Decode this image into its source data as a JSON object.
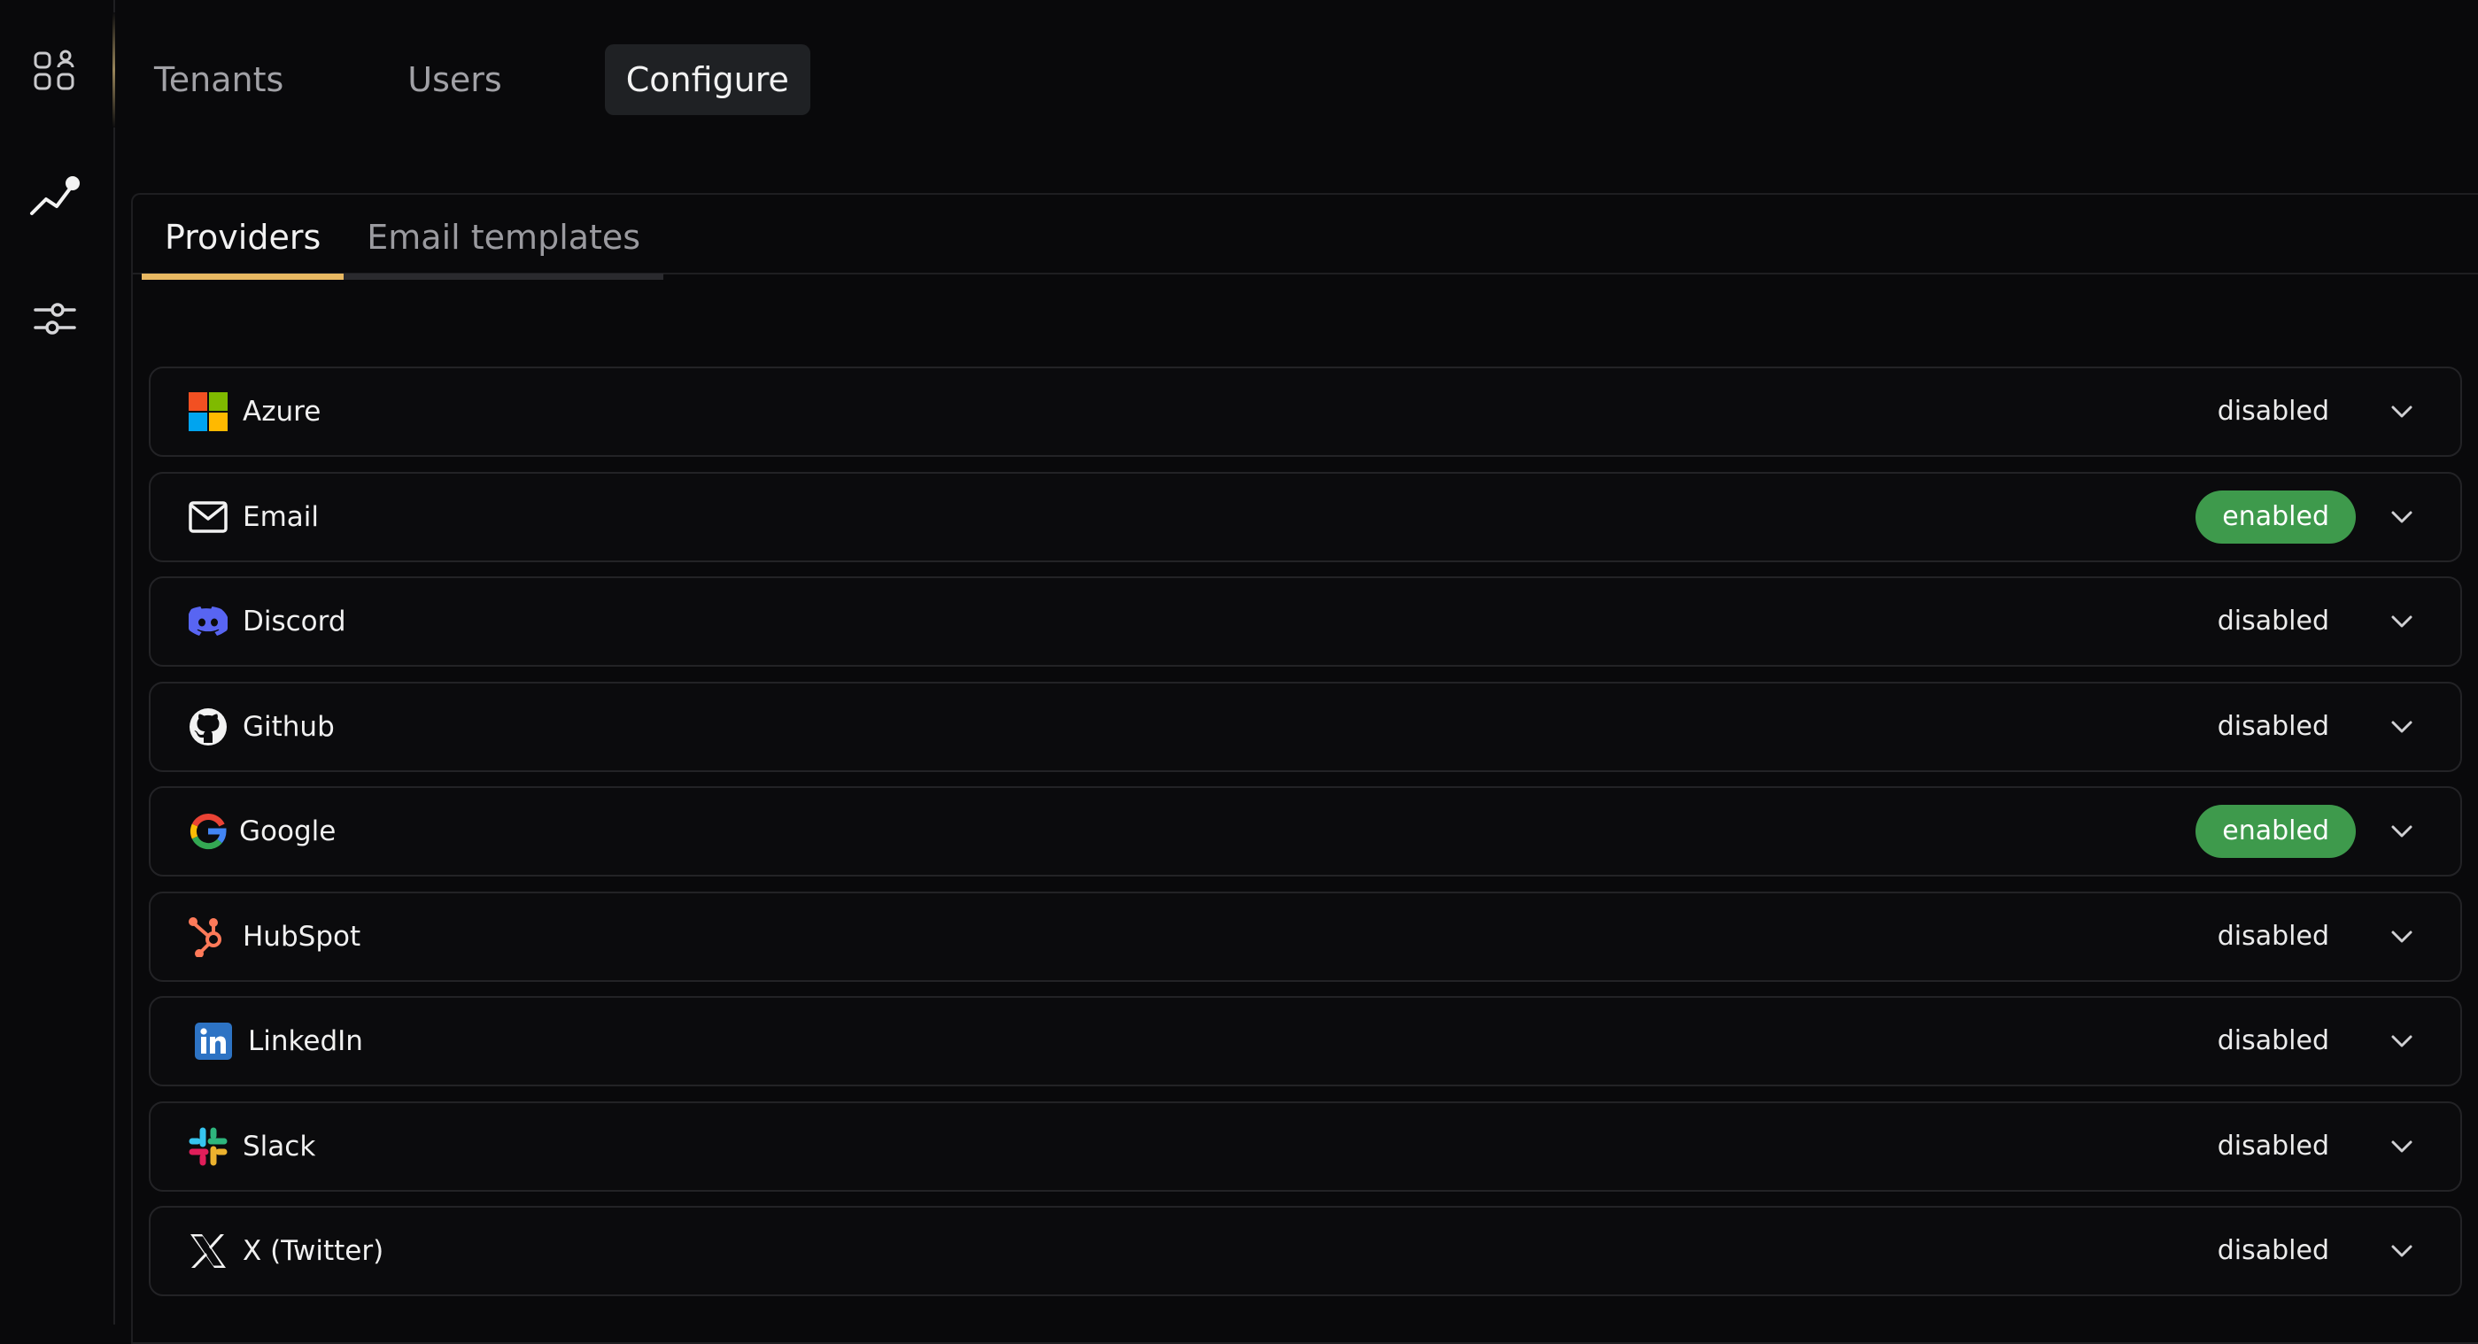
{
  "rail": {
    "items": [
      {
        "icon": "apps-users-icon"
      },
      {
        "icon": "analytics-icon"
      },
      {
        "icon": "sliders-icon"
      }
    ]
  },
  "topnav": {
    "tabs": [
      {
        "label": "Tenants",
        "active": false
      },
      {
        "label": "Users",
        "active": false
      },
      {
        "label": "Configure",
        "active": true
      }
    ]
  },
  "subtabs": {
    "items": [
      {
        "label": "Providers",
        "active": true
      },
      {
        "label": "Email templates",
        "active": false
      }
    ]
  },
  "colors": {
    "accent": "#e8b862",
    "enabled": "#3e9a4c",
    "background": "#09090b"
  },
  "providers": [
    {
      "name": "Azure",
      "icon": "azure-icon",
      "status": "disabled"
    },
    {
      "name": "Email",
      "icon": "email-icon",
      "status": "enabled"
    },
    {
      "name": "Discord",
      "icon": "discord-icon",
      "status": "disabled"
    },
    {
      "name": "Github",
      "icon": "github-icon",
      "status": "disabled"
    },
    {
      "name": "Google",
      "icon": "google-icon",
      "status": "enabled"
    },
    {
      "name": "HubSpot",
      "icon": "hubspot-icon",
      "status": "disabled"
    },
    {
      "name": "LinkedIn",
      "icon": "linkedin-icon",
      "status": "disabled"
    },
    {
      "name": "Slack",
      "icon": "slack-icon",
      "status": "disabled"
    },
    {
      "name": "X (Twitter)",
      "icon": "x-twitter-icon",
      "status": "disabled"
    }
  ]
}
